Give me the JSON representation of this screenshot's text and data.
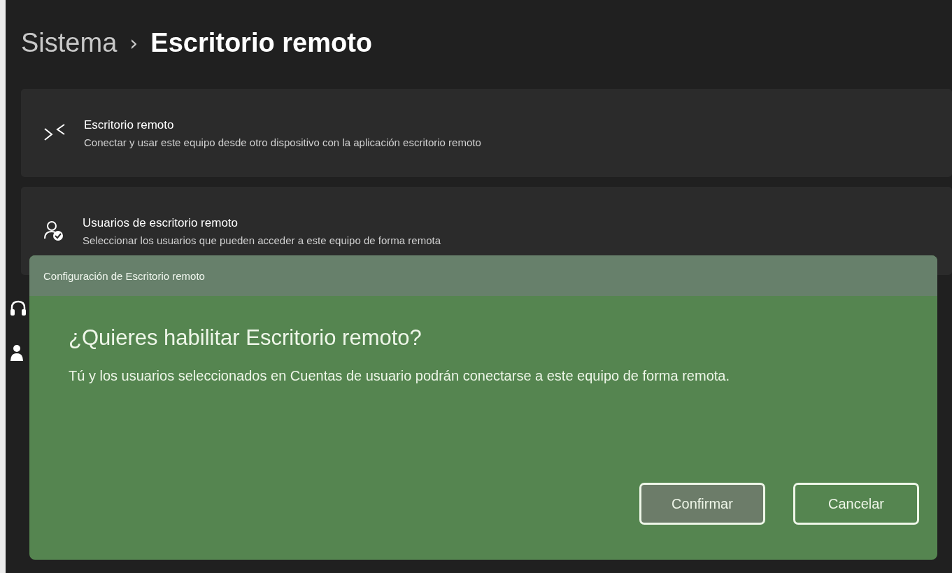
{
  "breadcrumb": {
    "parent": "Sistema",
    "separator": "›",
    "current": "Escritorio remoto"
  },
  "cards": [
    {
      "kind": "remote",
      "title": "Escritorio remoto",
      "description": "Conectar y usar este equipo desde otro dispositivo con la aplicación escritorio remoto"
    },
    {
      "kind": "users",
      "title": "Usuarios de escritorio remoto",
      "description": "Seleccionar los usuarios que pueden acceder a este equipo de forma remota"
    }
  ],
  "hidden_rows": [
    {
      "kind": "headset"
    },
    {
      "kind": "person"
    }
  ],
  "dialog": {
    "title": "Configuración de Escritorio remoto",
    "heading": "¿Quieres habilitar Escritorio remoto?",
    "message": "Tú y los usuarios seleccionados en Cuentas de usuario podrán conectarse a este equipo de forma remota.",
    "buttons": [
      {
        "label": "Confirmar",
        "selected": true
      },
      {
        "label": "Cancelar",
        "selected": false
      }
    ]
  }
}
